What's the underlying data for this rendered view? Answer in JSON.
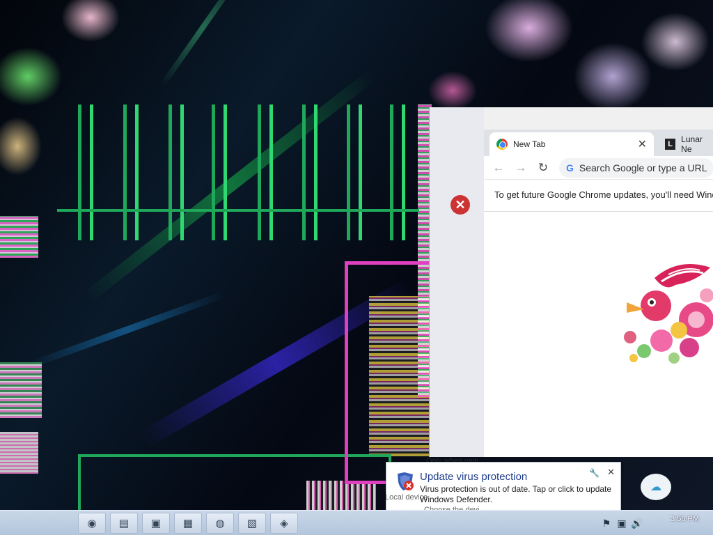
{
  "chrome": {
    "left_glyph": "✕",
    "tabs": [
      {
        "label": "New Tab",
        "icon": "chrome-icon",
        "active": true,
        "close": "✕"
      },
      {
        "label": "Lunar Ne",
        "icon": "site-icon",
        "site_letter": "L",
        "active": false
      }
    ],
    "toolbar": {
      "back": "←",
      "forward": "→",
      "reload": "↻",
      "omnibox_placeholder": "Search Google or type a URL",
      "search_engine_letter": "G"
    },
    "infobar_text": "To get future Google Chrome updates, you'll need Wind"
  },
  "toast": {
    "title": "Update virus protection",
    "body": "Virus protection is out of date. Tap or click to update Windows Defender.",
    "pin": "🔧",
    "close": "✕",
    "ghost_1": "Local device",
    "ghost_2": "Choose the devi",
    "ghost_3": "Only when usin"
  },
  "taskbar": {
    "buttons": [
      "chrome-icon",
      "app-icon",
      "app-icon",
      "app-icon",
      "app-icon",
      "app-icon",
      "app-icon"
    ],
    "button_glyphs": [
      "◉",
      "▤",
      "▣",
      "▦",
      "◍",
      "▧",
      "◈"
    ],
    "clock_time": "3:56 PM",
    "tray_glyphs": [
      "⚑",
      "▣",
      "🔊"
    ]
  },
  "edge_widget_glyph": "☁",
  "colors": {
    "accent": "#1a73e8",
    "toast_title": "#1f3e8c",
    "glitch_green": "#1fa85a",
    "glitch_pink": "#e040c0"
  }
}
